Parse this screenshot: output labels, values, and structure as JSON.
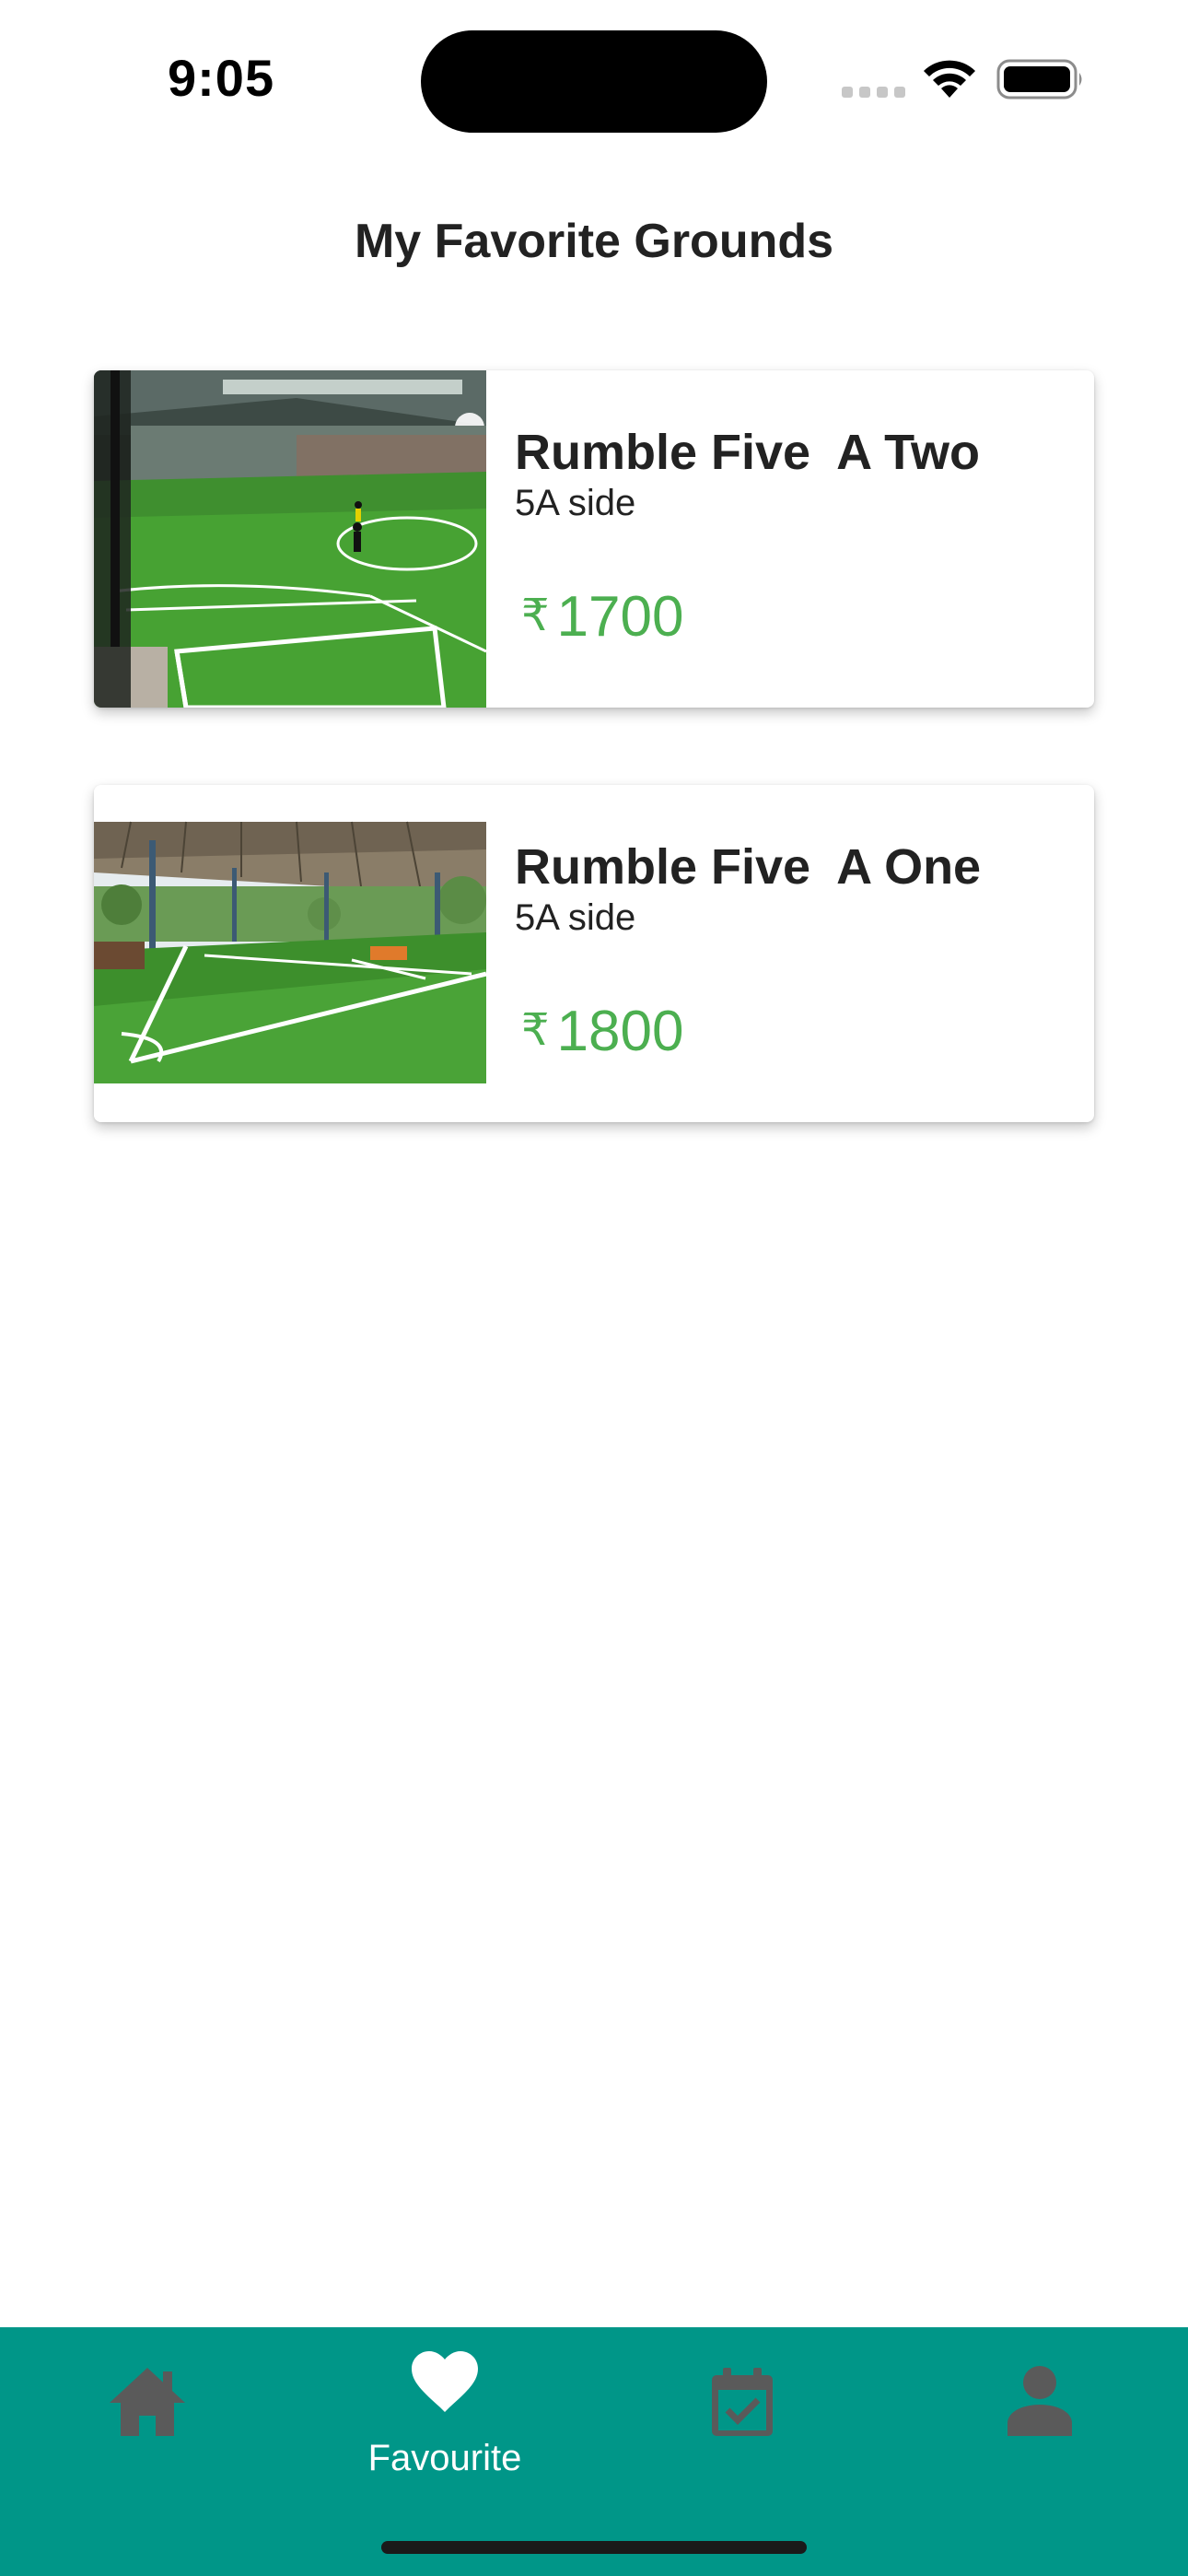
{
  "status_bar": {
    "time": "9:05"
  },
  "page": {
    "title": "My Favorite Grounds"
  },
  "grounds": [
    {
      "name": "Rumble Five  A Two",
      "type": "5A side",
      "currency": "₹",
      "price": "1700",
      "image": "indoor-football-turf-photo"
    },
    {
      "name": "Rumble Five  A One",
      "type": "5A side",
      "currency": "₹",
      "price": "1800",
      "image": "outdoor-covered-turf-photo"
    }
  ],
  "bottom_nav": {
    "items": [
      {
        "icon": "home-icon",
        "label": "",
        "active": false
      },
      {
        "icon": "heart-icon",
        "label": "Favourite",
        "active": true
      },
      {
        "icon": "calendar-check-icon",
        "label": "",
        "active": false
      },
      {
        "icon": "person-icon",
        "label": "",
        "active": false
      }
    ]
  },
  "colors": {
    "nav_background": "#009688",
    "price": "#4caf50",
    "nav_inactive_icon": "#5a5a5a",
    "nav_active_icon": "#ffffff"
  }
}
